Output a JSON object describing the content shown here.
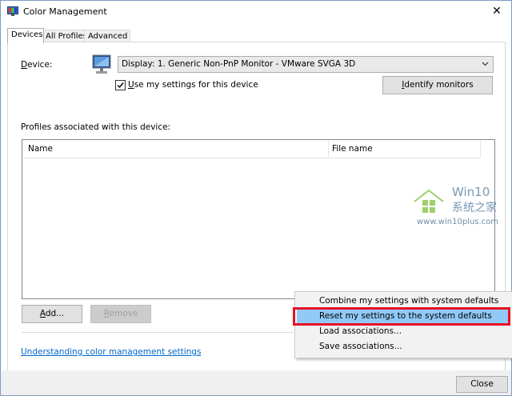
{
  "window": {
    "title": "Color Management",
    "close_glyph": "✕"
  },
  "tabs": [
    {
      "label": "Devices",
      "active": true
    },
    {
      "label": "All Profiles",
      "active": false
    },
    {
      "label": "Advanced",
      "active": false
    }
  ],
  "device": {
    "label_u": "D",
    "label_rest": "evice:",
    "selected": "Display: 1. Generic Non-PnP Monitor - VMware SVGA 3D",
    "checkbox_u": "U",
    "checkbox_rest": "se my settings for this device",
    "checkbox_checked": true,
    "identify_u": "I",
    "identify_rest": "dentify monitors"
  },
  "profiles": {
    "heading": "Profiles associated with this device:",
    "columns": [
      "Name",
      "File name"
    ],
    "rows": []
  },
  "buttons": {
    "add_u": "A",
    "add_rest": "dd...",
    "remove_u": "R",
    "remove_rest": "emove"
  },
  "link": "Understanding color management settings",
  "context_menu": {
    "items": [
      {
        "label": "Combine my settings with system defaults",
        "highlighted": false
      },
      {
        "label": "Reset my settings to the system defaults",
        "highlighted": true
      },
      {
        "label": "Load associations...",
        "highlighted": false
      },
      {
        "label": "Save associations...",
        "highlighted": false
      }
    ]
  },
  "watermark": {
    "title": "Win10",
    "subtitle": "系统之家",
    "url": "www.win10plus.com"
  },
  "footer": {
    "close_label": "Close"
  },
  "colors": {
    "accent": "#0066cc",
    "highlight": "#91c9f7",
    "annotation": "#e81123"
  }
}
